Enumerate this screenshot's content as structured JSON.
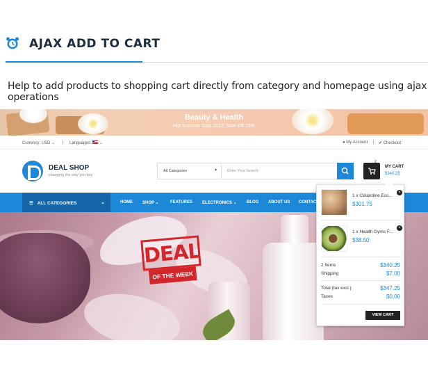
{
  "section": {
    "title": "AJAX ADD TO CART",
    "description": "Help to add products to shopping cart directly from category and homepage using ajax operations",
    "accent_color": "#1e88d8"
  },
  "promo": {
    "title": "Beauty & Health",
    "subtitle": "Hot Summer Sale 2017, Sale Off 75%"
  },
  "topbar": {
    "currency": "Currency: USD",
    "languages": "Languages:",
    "my_account": "My Account",
    "checkout": "Checkout"
  },
  "header": {
    "logo_name": "DEAL SHOP",
    "logo_tagline": "changing the way you buy",
    "search_category": "All Categories",
    "search_placeholder": "Enter Your Search",
    "cart_count": "2",
    "cart_label": "MY CART",
    "cart_total": "$340.25"
  },
  "nav": {
    "all_categories": "ALL CATEGORIES",
    "items": [
      "HOME",
      "SHOP",
      "FEATURES",
      "ELECTRONICS",
      "BLOG",
      "ABOUT US",
      "CONTACT"
    ]
  },
  "hero": {
    "stamp_main": "DEAL",
    "stamp_sub": "OF THE WEEK"
  },
  "minicart": {
    "items": [
      {
        "name": "1 x Celandine Ess...",
        "price": "$301.75"
      },
      {
        "name": "1 x Health Gyms F...",
        "price": "$38.50"
      }
    ],
    "items_label": "2 Items",
    "items_value": "$340.25",
    "shipping_label": "Shipping",
    "shipping_value": "$7.00",
    "total_label": "Total (tax excl.)",
    "total_value": "$347.25",
    "taxes_label": "Taxes",
    "taxes_value": "$0.00",
    "view_cart": "VIEW CART"
  }
}
